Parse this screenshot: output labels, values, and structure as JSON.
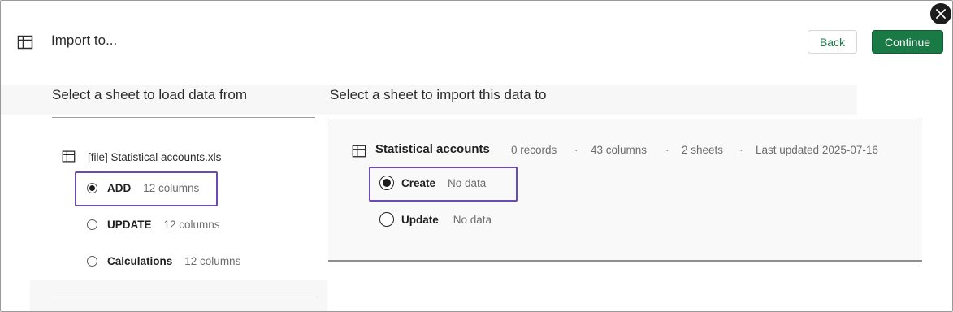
{
  "header": {
    "title": "Import to...",
    "back_label": "Back",
    "continue_label": "Continue"
  },
  "left": {
    "heading": "Select a sheet to load data from",
    "file_name": "[file] Statistical accounts.xls",
    "options": [
      {
        "label": "ADD",
        "meta": "12 columns",
        "selected": true
      },
      {
        "label": "UPDATE",
        "meta": "12 columns",
        "selected": false
      },
      {
        "label": "Calculations",
        "meta": "12 columns",
        "selected": false
      }
    ]
  },
  "right": {
    "heading": "Select a sheet to import this data to",
    "sheet_name": "Statistical accounts",
    "records": "0 records",
    "columns": "43 columns",
    "sheets": "2 sheets",
    "last_updated": "Last updated 2025-07-16",
    "separator": "·",
    "options": [
      {
        "label": "Create",
        "meta": "No data",
        "selected": true
      },
      {
        "label": "Update",
        "meta": "No data",
        "selected": false
      }
    ]
  },
  "colors": {
    "accent_green": "#1a7a45",
    "highlight_purple": "#6a4bb3"
  },
  "icons": [
    "close-icon",
    "table-icon"
  ]
}
